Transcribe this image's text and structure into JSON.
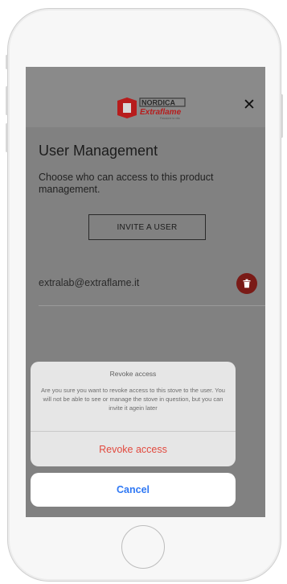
{
  "logo": {
    "name": "Nordica Extraflame",
    "brand_top": "NORDICA",
    "brand_bottom": "Extraflame",
    "tagline": "Passione la vita"
  },
  "header": {
    "close_symbol": "✕"
  },
  "main": {
    "title": "User Management",
    "description": "Choose who can access to this product management.",
    "invite_label": "INVITE A USER",
    "users": [
      {
        "email": "extralab@extraflame.it"
      }
    ]
  },
  "sheet": {
    "title": "Revoke access",
    "message": "Are you sure you want to revoke access to this stove to the user. You will not be able to see or manage the stove in question, but you can invite it agein later",
    "action_label": "Revoke access",
    "cancel_label": "Cancel"
  },
  "colors": {
    "destructive": "#e24a3f",
    "ios_blue": "#2f78f4",
    "trash_button": "#7a1b17",
    "brand_red": "#b71c1c"
  },
  "icons": {
    "close": "close-icon",
    "delete": "trash-icon"
  }
}
